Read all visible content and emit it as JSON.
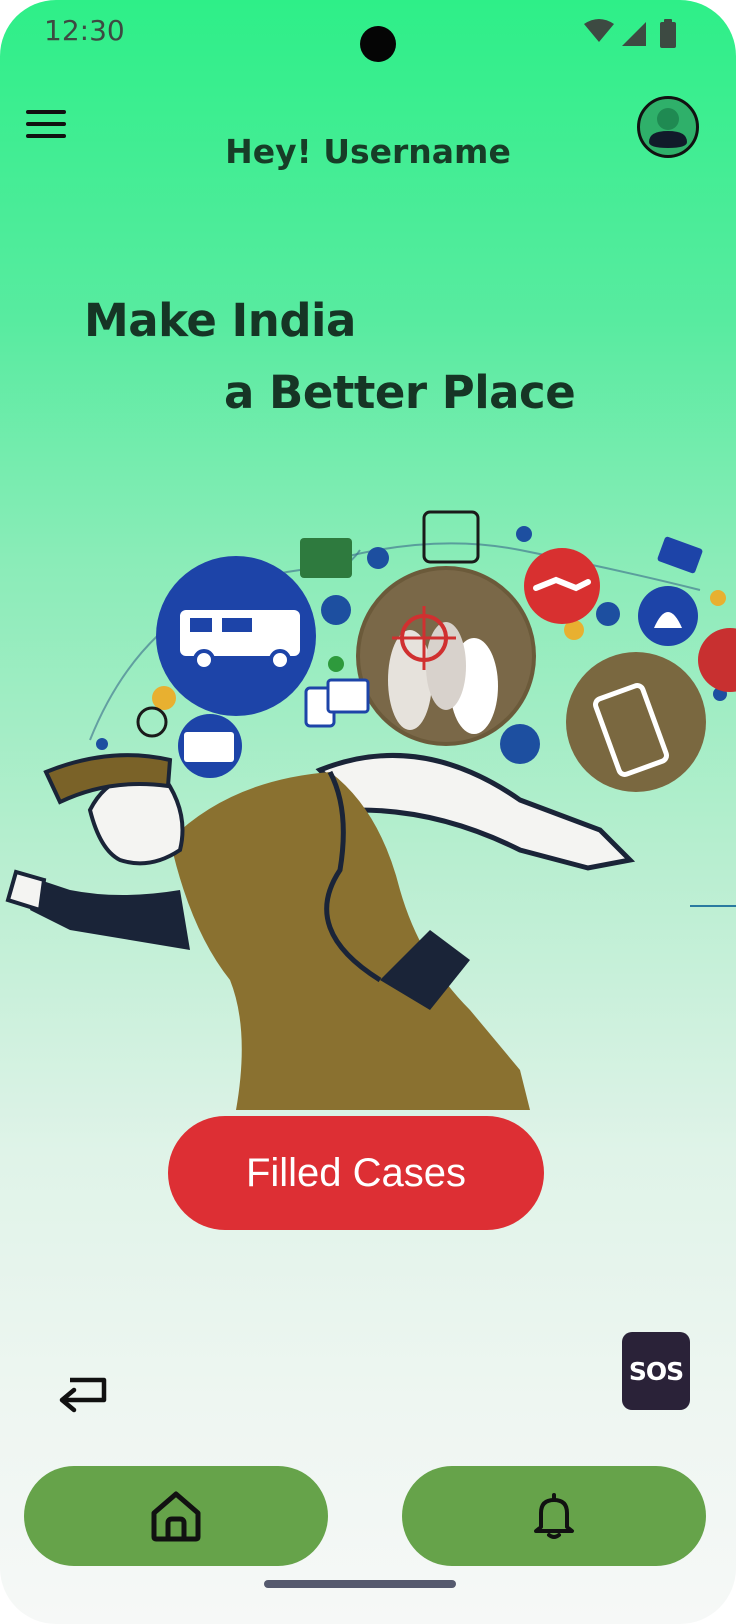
{
  "status_bar": {
    "time": "12:30",
    "icons": [
      "wifi-icon",
      "cellular-signal-icon",
      "battery-icon"
    ]
  },
  "header": {
    "menu_icon": "hamburger-menu-icon",
    "greeting": "Hey!  Username",
    "avatar_icon": "user-avatar-icon"
  },
  "hero": {
    "line1": "Make India",
    "line2": "a Better Place",
    "illustration": "police-officer-illustration"
  },
  "actions": {
    "filled_cases_label": "Filled Cases",
    "sos_label": "SOS",
    "back_icon": "return-arrow-icon"
  },
  "bottom_nav": {
    "home_icon": "home-icon",
    "notifications_icon": "bell-icon"
  },
  "colors": {
    "accent_green": "#66a34a",
    "primary_red": "#dd2f34",
    "sos_dark": "#2a2238",
    "heading_text": "#163525",
    "gradient_top": "#2eef88"
  }
}
